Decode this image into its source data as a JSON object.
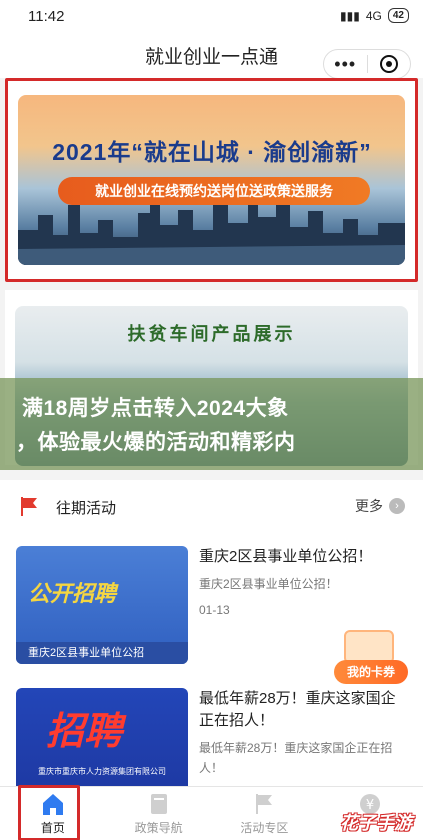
{
  "status": {
    "time": "11:42",
    "network": "4G",
    "battery": "42"
  },
  "nav": {
    "title": "就业创业一点通"
  },
  "banner": {
    "title": "2021年“就在山城 · 渝创渝新”",
    "subtitle": "就业创业在线预约送岗位送政策送服务"
  },
  "banner2": {
    "title": "扶贫车间产品展示"
  },
  "watermark": {
    "line1": "满18周岁点击转入2024大象",
    "line2": "，体验最火爆的活动和精彩内"
  },
  "section": {
    "title": "往期活动",
    "more": "更多"
  },
  "items": [
    {
      "title": "重庆2区县事业单位公招！",
      "subtitle": "重庆2区县事业单位公招！",
      "date": "01-13",
      "thumb_big": "公开招聘",
      "thumb_strip": "重庆2区县事业单位公招"
    },
    {
      "title": "最低年薪28万！重庆这家国企正在招人！",
      "subtitle": "最低年薪28万！重庆这家国企正在招人！",
      "thumb_big": "招聘",
      "thumb_top": "重庆市重庆市人力资源集团有限公司"
    }
  ],
  "card": {
    "label": "我的卡券"
  },
  "tabs": [
    {
      "label": "首页"
    },
    {
      "label": "政策导航"
    },
    {
      "label": "活动专区"
    },
    {
      "label": ""
    }
  ],
  "site_badge": "花子手游",
  "colors": {
    "highlight": "#d42a2a",
    "accent": "#ff6a26"
  }
}
